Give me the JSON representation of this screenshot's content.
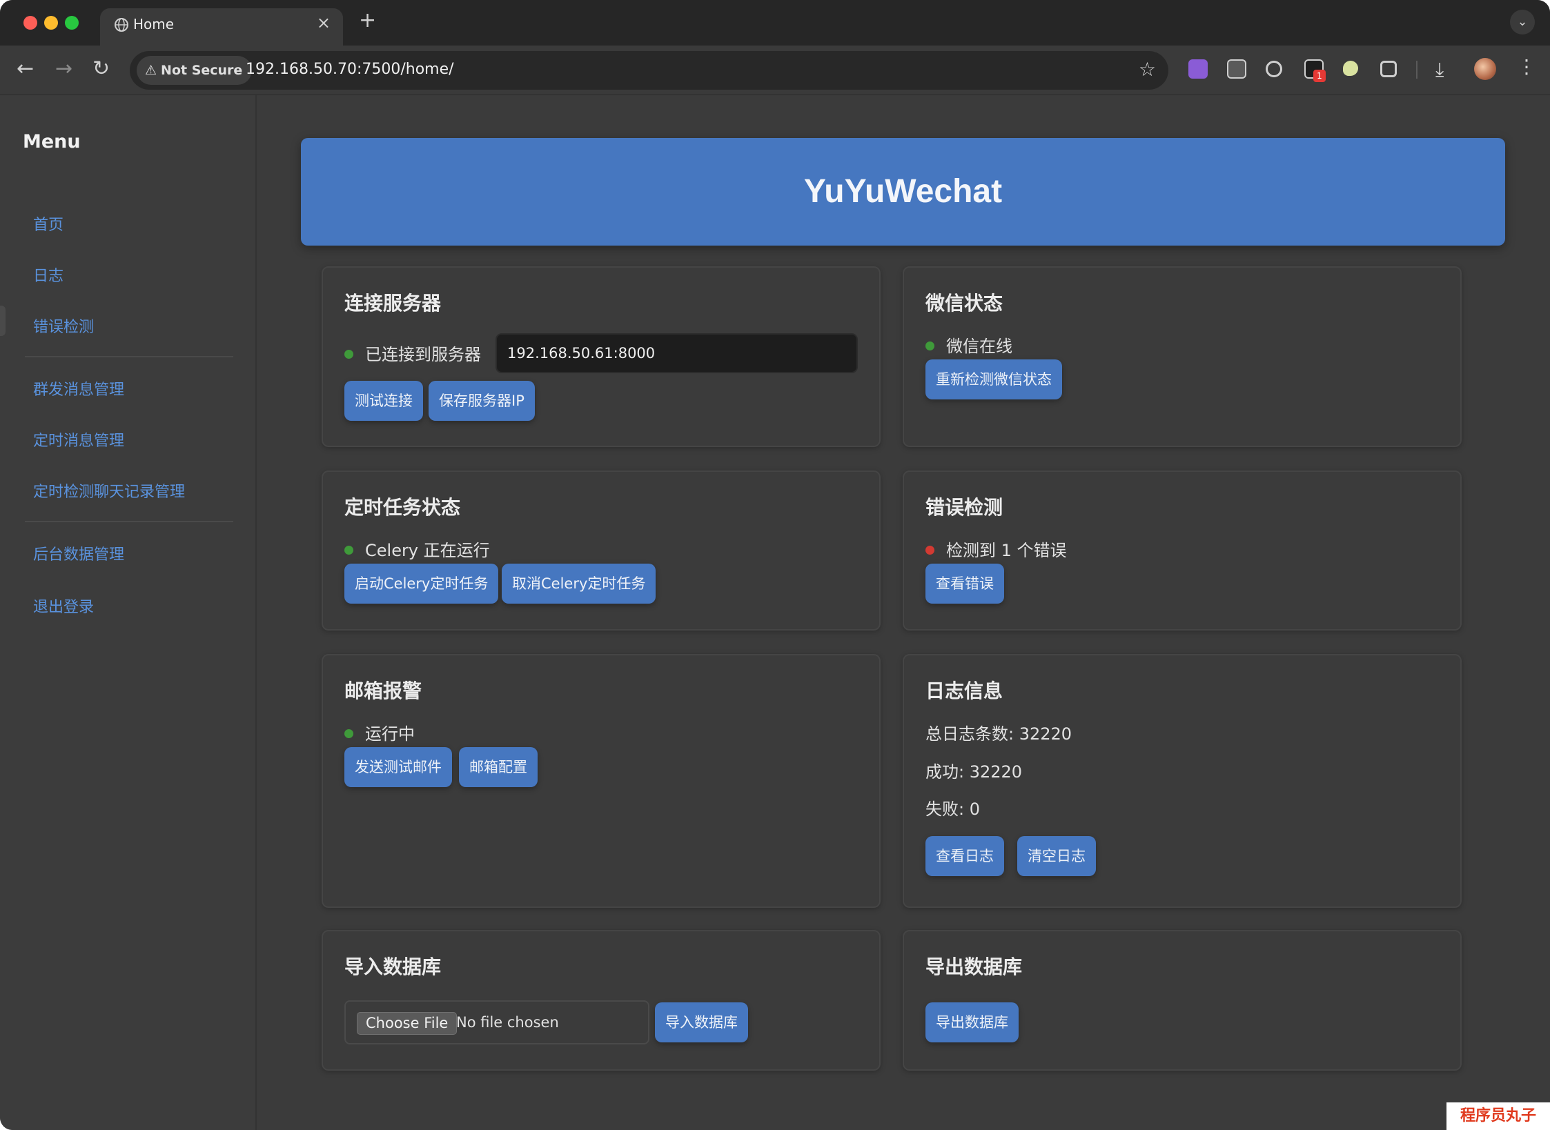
{
  "browser": {
    "tab_title": "Home",
    "tab_close": "×",
    "new_tab": "+",
    "security_label": "Not Secure",
    "url": "192.168.50.70:7500/home/",
    "extension_badge": "1"
  },
  "sidebar": {
    "title": "Menu",
    "items": [
      {
        "label": "首页"
      },
      {
        "label": "日志"
      },
      {
        "label": "错误检测"
      },
      {
        "label": "群发消息管理"
      },
      {
        "label": "定时消息管理"
      },
      {
        "label": "定时检测聊天记录管理"
      },
      {
        "label": "后台数据管理"
      },
      {
        "label": "退出登录"
      }
    ]
  },
  "banner": {
    "title": "YuYuWechat"
  },
  "server": {
    "title": "连接服务器",
    "status": "已连接到服务器",
    "address_value": "192.168.50.61:8000",
    "buttons": {
      "test": "测试连接",
      "save": "保存服务器IP"
    }
  },
  "wechat": {
    "title": "微信状态",
    "status": "微信在线",
    "buttons": {
      "recheck": "重新检测微信状态"
    }
  },
  "scheduler": {
    "title": "定时任务状态",
    "status": "Celery 正在运行",
    "buttons": {
      "start": "启动Celery定时任务",
      "cancel": "取消Celery定时任务"
    }
  },
  "errors": {
    "title": "错误检测",
    "status": "检测到 1 个错误",
    "buttons": {
      "view": "查看错误"
    }
  },
  "mail": {
    "title": "邮箱报警",
    "status": "运行中",
    "buttons": {
      "send_test": "发送测试邮件",
      "config": "邮箱配置"
    }
  },
  "logs": {
    "title": "日志信息",
    "total": "总日志条数: 32220",
    "success": "成功: 32220",
    "failed": "失败: 0",
    "buttons": {
      "view": "查看日志",
      "clear": "清空日志"
    }
  },
  "import_db": {
    "title": "导入数据库",
    "choose_file": "Choose File",
    "no_file": "No file chosen",
    "buttons": {
      "import": "导入数据库"
    }
  },
  "export_db": {
    "title": "导出数据库",
    "buttons": {
      "export": "导出数据库"
    }
  },
  "watermark": "程序员丸子",
  "colors": {
    "accent": "#4677c0",
    "link": "#5a93df",
    "status_ok": "#3f9a3a",
    "status_error": "#d33a32",
    "background": "#3b3b3b"
  }
}
